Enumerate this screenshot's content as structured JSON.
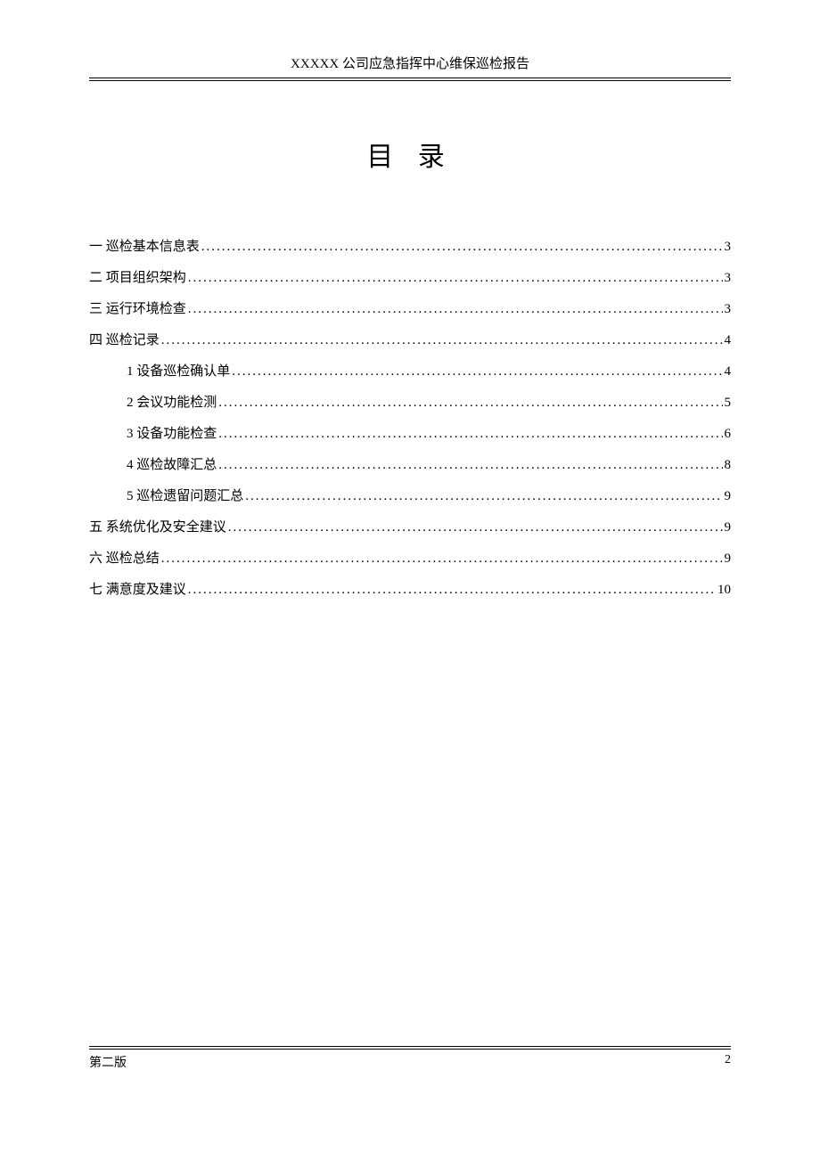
{
  "header": {
    "text": "XXXXX 公司应急指挥中心维保巡检报告"
  },
  "title": "目 录",
  "toc": [
    {
      "label": "一 巡检基本信息表",
      "page": "3",
      "level": 0
    },
    {
      "label": "二 项目组织架构",
      "page": "3",
      "level": 0
    },
    {
      "label": "三 运行环境检查",
      "page": "3",
      "level": 0
    },
    {
      "label": "四 巡检记录",
      "page": "4",
      "level": 0
    },
    {
      "label": "1 设备巡检确认单",
      "page": "4",
      "level": 1
    },
    {
      "label": "2 会议功能检测",
      "page": "5",
      "level": 1
    },
    {
      "label": "3 设备功能检查",
      "page": "6",
      "level": 1
    },
    {
      "label": "4 巡检故障汇总",
      "page": "8",
      "level": 1
    },
    {
      "label": "5 巡检遗留问题汇总",
      "page": "9",
      "level": 1
    },
    {
      "label": "五 系统优化及安全建议",
      "page": "9",
      "level": 0
    },
    {
      "label": "六 巡检总结",
      "page": "9",
      "level": 0
    },
    {
      "label": "七 满意度及建议",
      "page": "10",
      "level": 0
    }
  ],
  "footer": {
    "version": "第二版",
    "pageNum": "2"
  }
}
